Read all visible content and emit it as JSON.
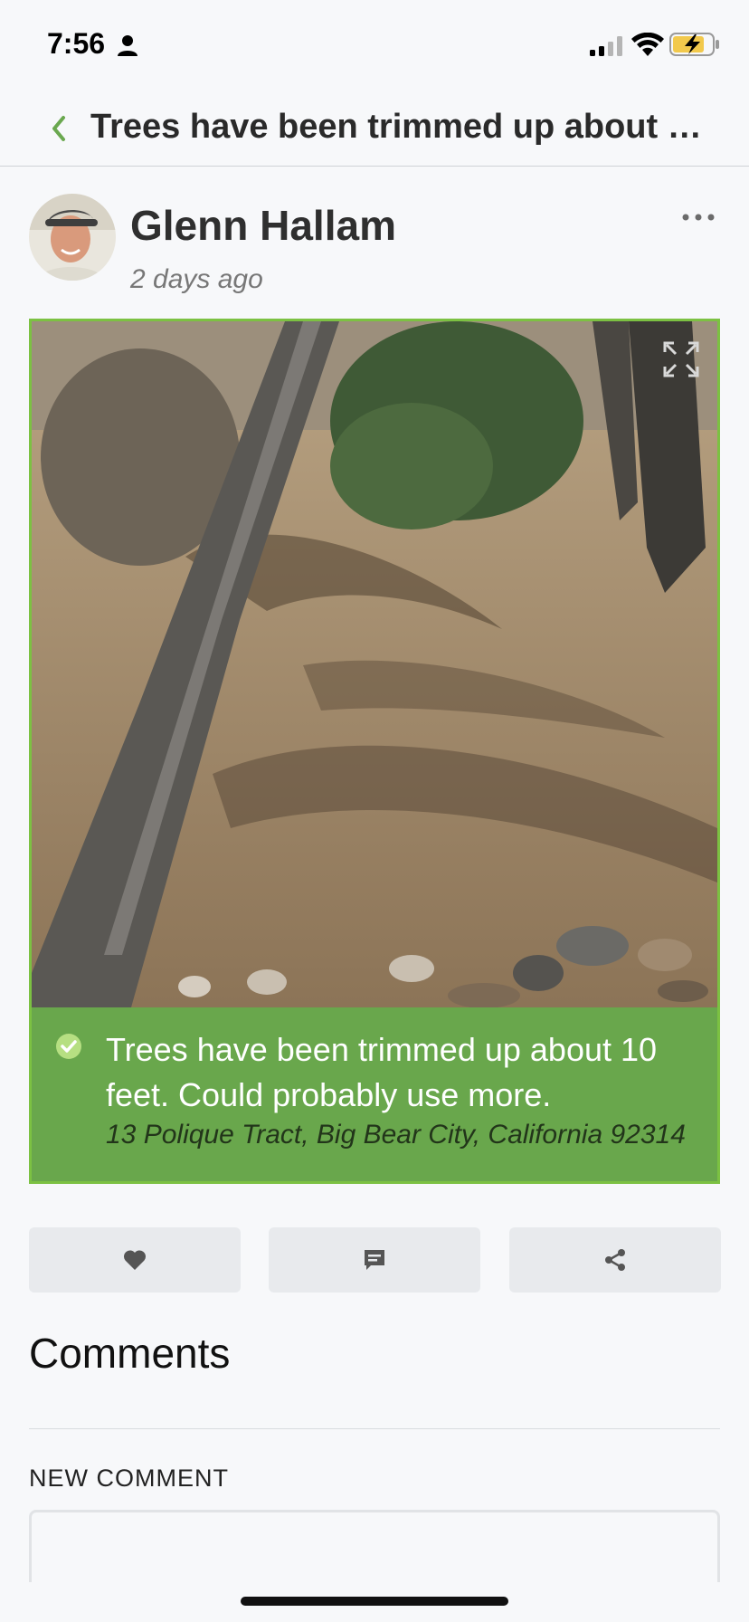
{
  "status_bar": {
    "time": "7:56"
  },
  "nav": {
    "title": "Trees have been trimmed up about 10 feet. Could probably use more."
  },
  "post": {
    "author": "Glenn Hallam",
    "time_ago": "2 days ago",
    "caption": "Trees have been trimmed up about 10 feet. Could probably use more.",
    "address": "13 Polique Tract, Big Bear City, California 92314"
  },
  "comments": {
    "heading": "Comments",
    "new_comment_label": "NEW COMMENT"
  },
  "colors": {
    "accent_green": "#7cc142",
    "caption_bg": "#69a74c",
    "button_bg": "#e8eaed"
  },
  "icons": [
    "person-icon",
    "signal-icon",
    "wifi-icon",
    "battery-charging-icon",
    "back-chevron-icon",
    "more-options-icon",
    "expand-icon",
    "check-circle-icon",
    "heart-icon",
    "comment-icon",
    "share-icon"
  ]
}
